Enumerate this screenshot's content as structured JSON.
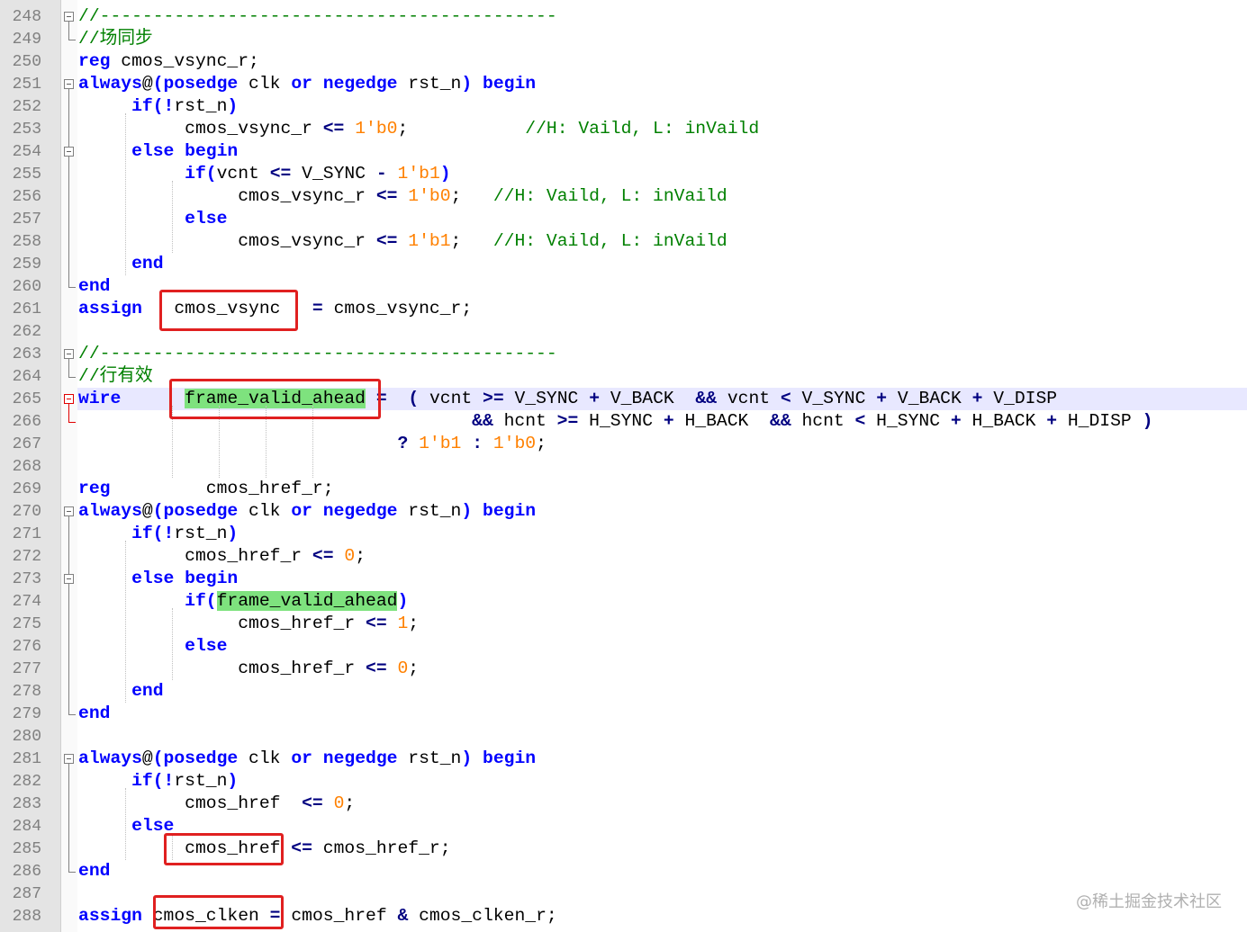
{
  "editor": {
    "lines": [
      {
        "num": "248",
        "tokens": [
          {
            "t": "//-------------------------------------------",
            "c": "cm"
          }
        ]
      },
      {
        "num": "249",
        "tokens": [
          {
            "t": "//场同步",
            "c": "cm"
          }
        ]
      },
      {
        "num": "250",
        "tokens": [
          {
            "t": "reg",
            "c": "kw"
          },
          {
            "t": " cmos_vsync_r;"
          }
        ]
      },
      {
        "num": "251",
        "tokens": [
          {
            "t": "always",
            "c": "kw"
          },
          {
            "t": "@"
          },
          {
            "t": "(posedge",
            "c": "kw"
          },
          {
            "t": " clk "
          },
          {
            "t": "or",
            "c": "kw"
          },
          {
            "t": " "
          },
          {
            "t": "negedge",
            "c": "kw"
          },
          {
            "t": " rst_n"
          },
          {
            "t": ")",
            "c": "kw"
          },
          {
            "t": " "
          },
          {
            "t": "begin",
            "c": "kw"
          }
        ]
      },
      {
        "num": "252",
        "tokens": [
          {
            "t": "     "
          },
          {
            "t": "if(!",
            "c": "kw"
          },
          {
            "t": "rst_n"
          },
          {
            "t": ")",
            "c": "kw"
          }
        ]
      },
      {
        "num": "253",
        "tokens": [
          {
            "t": "          cmos_vsync_r "
          },
          {
            "t": "<=",
            "c": "op"
          },
          {
            "t": " "
          },
          {
            "t": "1'b0",
            "c": "nm"
          },
          {
            "t": ";           "
          },
          {
            "t": "//H: Vaild, L: inVaild",
            "c": "cm"
          }
        ]
      },
      {
        "num": "254",
        "tokens": [
          {
            "t": "     "
          },
          {
            "t": "else begin",
            "c": "kw"
          }
        ]
      },
      {
        "num": "255",
        "tokens": [
          {
            "t": "          "
          },
          {
            "t": "if(",
            "c": "kw"
          },
          {
            "t": "vcnt "
          },
          {
            "t": "<=",
            "c": "op"
          },
          {
            "t": " V_SYNC "
          },
          {
            "t": "-",
            "c": "op"
          },
          {
            "t": " "
          },
          {
            "t": "1'b1",
            "c": "nm"
          },
          {
            "t": ")",
            "c": "kw"
          }
        ]
      },
      {
        "num": "256",
        "tokens": [
          {
            "t": "               cmos_vsync_r "
          },
          {
            "t": "<=",
            "c": "op"
          },
          {
            "t": " "
          },
          {
            "t": "1'b0",
            "c": "nm"
          },
          {
            "t": ";   "
          },
          {
            "t": "//H: Vaild, L: inVaild",
            "c": "cm"
          }
        ]
      },
      {
        "num": "257",
        "tokens": [
          {
            "t": "          "
          },
          {
            "t": "else",
            "c": "kw"
          }
        ]
      },
      {
        "num": "258",
        "tokens": [
          {
            "t": "               cmos_vsync_r "
          },
          {
            "t": "<=",
            "c": "op"
          },
          {
            "t": " "
          },
          {
            "t": "1'b1",
            "c": "nm"
          },
          {
            "t": ";   "
          },
          {
            "t": "//H: Vaild, L: inVaild",
            "c": "cm"
          }
        ]
      },
      {
        "num": "259",
        "tokens": [
          {
            "t": "     "
          },
          {
            "t": "end",
            "c": "kw"
          }
        ]
      },
      {
        "num": "260",
        "tokens": [
          {
            "t": "end",
            "c": "kw"
          }
        ]
      },
      {
        "num": "261",
        "tokens": [
          {
            "t": "assign",
            "c": "kw"
          },
          {
            "t": "   cmos_vsync   "
          },
          {
            "t": "=",
            "c": "op"
          },
          {
            "t": " cmos_vsync_r;"
          }
        ]
      },
      {
        "num": "262",
        "tokens": []
      },
      {
        "num": "263",
        "tokens": [
          {
            "t": "//-------------------------------------------",
            "c": "cm"
          }
        ]
      },
      {
        "num": "264",
        "tokens": [
          {
            "t": "//行有效",
            "c": "cm"
          }
        ]
      },
      {
        "num": "265",
        "tokens": [
          {
            "t": "wire",
            "c": "kw"
          },
          {
            "t": "      "
          },
          {
            "t": "frame_valid_ahead",
            "c": "hl"
          },
          {
            "t": " "
          },
          {
            "t": "=",
            "c": "op"
          },
          {
            "t": "  "
          },
          {
            "t": "(",
            "c": "op"
          },
          {
            "t": " vcnt "
          },
          {
            "t": ">=",
            "c": "op"
          },
          {
            "t": " V_SYNC "
          },
          {
            "t": "+",
            "c": "op"
          },
          {
            "t": " V_BACK  "
          },
          {
            "t": "&&",
            "c": "op"
          },
          {
            "t": " vcnt "
          },
          {
            "t": "<",
            "c": "op"
          },
          {
            "t": " V_SYNC "
          },
          {
            "t": "+",
            "c": "op"
          },
          {
            "t": " V_BACK "
          },
          {
            "t": "+",
            "c": "op"
          },
          {
            "t": " V_DISP"
          }
        ]
      },
      {
        "num": "266",
        "tokens": [
          {
            "t": "                                     "
          },
          {
            "t": "&&",
            "c": "op"
          },
          {
            "t": " hcnt "
          },
          {
            "t": ">=",
            "c": "op"
          },
          {
            "t": " H_SYNC "
          },
          {
            "t": "+",
            "c": "op"
          },
          {
            "t": " H_BACK  "
          },
          {
            "t": "&&",
            "c": "op"
          },
          {
            "t": " hcnt "
          },
          {
            "t": "<",
            "c": "op"
          },
          {
            "t": " H_SYNC "
          },
          {
            "t": "+",
            "c": "op"
          },
          {
            "t": " H_BACK "
          },
          {
            "t": "+",
            "c": "op"
          },
          {
            "t": " H_DISP "
          },
          {
            "t": ")",
            "c": "op"
          }
        ]
      },
      {
        "num": "267",
        "tokens": [
          {
            "t": "                              "
          },
          {
            "t": "?",
            "c": "op"
          },
          {
            "t": " "
          },
          {
            "t": "1'b1",
            "c": "nm"
          },
          {
            "t": " "
          },
          {
            "t": ":",
            "c": "op"
          },
          {
            "t": " "
          },
          {
            "t": "1'b0",
            "c": "nm"
          },
          {
            "t": ";"
          }
        ]
      },
      {
        "num": "268",
        "tokens": []
      },
      {
        "num": "269",
        "tokens": [
          {
            "t": "reg",
            "c": "kw"
          },
          {
            "t": "         cmos_href_r;"
          }
        ]
      },
      {
        "num": "270",
        "tokens": [
          {
            "t": "always",
            "c": "kw"
          },
          {
            "t": "@"
          },
          {
            "t": "(posedge",
            "c": "kw"
          },
          {
            "t": " clk "
          },
          {
            "t": "or",
            "c": "kw"
          },
          {
            "t": " "
          },
          {
            "t": "negedge",
            "c": "kw"
          },
          {
            "t": " rst_n"
          },
          {
            "t": ")",
            "c": "kw"
          },
          {
            "t": " "
          },
          {
            "t": "begin",
            "c": "kw"
          }
        ]
      },
      {
        "num": "271",
        "tokens": [
          {
            "t": "     "
          },
          {
            "t": "if(!",
            "c": "kw"
          },
          {
            "t": "rst_n"
          },
          {
            "t": ")",
            "c": "kw"
          }
        ]
      },
      {
        "num": "272",
        "tokens": [
          {
            "t": "          cmos_href_r "
          },
          {
            "t": "<=",
            "c": "op"
          },
          {
            "t": " "
          },
          {
            "t": "0",
            "c": "nm"
          },
          {
            "t": ";"
          }
        ]
      },
      {
        "num": "273",
        "tokens": [
          {
            "t": "     "
          },
          {
            "t": "else begin",
            "c": "kw"
          }
        ]
      },
      {
        "num": "274",
        "tokens": [
          {
            "t": "          "
          },
          {
            "t": "if(",
            "c": "kw"
          },
          {
            "t": "frame_valid_ahead",
            "c": "hl"
          },
          {
            "t": ")",
            "c": "kw"
          }
        ]
      },
      {
        "num": "275",
        "tokens": [
          {
            "t": "               cmos_href_r "
          },
          {
            "t": "<=",
            "c": "op"
          },
          {
            "t": " "
          },
          {
            "t": "1",
            "c": "nm"
          },
          {
            "t": ";"
          }
        ]
      },
      {
        "num": "276",
        "tokens": [
          {
            "t": "          "
          },
          {
            "t": "else",
            "c": "kw"
          }
        ]
      },
      {
        "num": "277",
        "tokens": [
          {
            "t": "               cmos_href_r "
          },
          {
            "t": "<=",
            "c": "op"
          },
          {
            "t": " "
          },
          {
            "t": "0",
            "c": "nm"
          },
          {
            "t": ";"
          }
        ]
      },
      {
        "num": "278",
        "tokens": [
          {
            "t": "     "
          },
          {
            "t": "end",
            "c": "kw"
          }
        ]
      },
      {
        "num": "279",
        "tokens": [
          {
            "t": "end",
            "c": "kw"
          }
        ]
      },
      {
        "num": "280",
        "tokens": []
      },
      {
        "num": "281",
        "tokens": [
          {
            "t": "always",
            "c": "kw"
          },
          {
            "t": "@"
          },
          {
            "t": "(posedge",
            "c": "kw"
          },
          {
            "t": " clk "
          },
          {
            "t": "or",
            "c": "kw"
          },
          {
            "t": " "
          },
          {
            "t": "negedge",
            "c": "kw"
          },
          {
            "t": " rst_n"
          },
          {
            "t": ")",
            "c": "kw"
          },
          {
            "t": " "
          },
          {
            "t": "begin",
            "c": "kw"
          }
        ]
      },
      {
        "num": "282",
        "tokens": [
          {
            "t": "     "
          },
          {
            "t": "if(!",
            "c": "kw"
          },
          {
            "t": "rst_n"
          },
          {
            "t": ")",
            "c": "kw"
          }
        ]
      },
      {
        "num": "283",
        "tokens": [
          {
            "t": "          cmos_href  "
          },
          {
            "t": "<=",
            "c": "op"
          },
          {
            "t": " "
          },
          {
            "t": "0",
            "c": "nm"
          },
          {
            "t": ";"
          }
        ]
      },
      {
        "num": "284",
        "tokens": [
          {
            "t": "     "
          },
          {
            "t": "else",
            "c": "kw"
          }
        ]
      },
      {
        "num": "285",
        "tokens": [
          {
            "t": "          cmos_href "
          },
          {
            "t": "<=",
            "c": "op"
          },
          {
            "t": " cmos_href_r;"
          }
        ]
      },
      {
        "num": "286",
        "tokens": [
          {
            "t": "end",
            "c": "kw"
          }
        ]
      },
      {
        "num": "287",
        "tokens": []
      },
      {
        "num": "288",
        "tokens": [
          {
            "t": "assign",
            "c": "kw"
          },
          {
            "t": " cmos_clken "
          },
          {
            "t": "=",
            "c": "op"
          },
          {
            "t": " cmos_href "
          },
          {
            "t": "&",
            "c": "op"
          },
          {
            "t": " cmos_clken_r;"
          }
        ]
      }
    ]
  },
  "watermark": "@稀土掘金技术社区",
  "colors": {
    "keyword": "#0000ff",
    "comment": "#008000",
    "number": "#ff8000",
    "operator": "#000080",
    "highlight": "#7ee27e",
    "annotation": "#e02020",
    "gutter": "#e4e4e4",
    "current_line": "#e8e8ff"
  }
}
